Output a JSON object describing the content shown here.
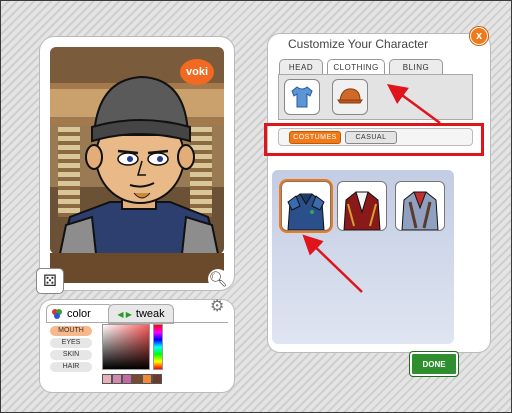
{
  "customize": {
    "title": "Customize Your Character",
    "close_label": "x",
    "tabs": [
      {
        "label": "HEAD",
        "active": false
      },
      {
        "label": "CLOTHING",
        "active": true
      },
      {
        "label": "BLING",
        "active": false
      }
    ],
    "categories": [
      {
        "icon": "shirt-icon",
        "active": true
      },
      {
        "icon": "cap-icon",
        "active": false
      }
    ],
    "styles": [
      {
        "label": "COSTUMES",
        "active": true
      },
      {
        "label": "CASUAL",
        "active": false
      }
    ],
    "items": [
      {
        "name": "blue-uniform-outfit",
        "selected": true
      },
      {
        "name": "red-coat-outfit",
        "selected": false
      },
      {
        "name": "denim-vest-outfit",
        "selected": false
      }
    ],
    "done_label": "DONE"
  },
  "character": {
    "logo_text": "voki",
    "dice_icon": "dice-icon",
    "zoom_icon": "magnifier-icon"
  },
  "color_panel": {
    "tab_color_label": "color",
    "tab_tweak_label": "tweak",
    "parts": [
      "MOUTH",
      "EYES",
      "SKIN",
      "HAIR"
    ],
    "active_part": "MOUTH",
    "swatches": [
      "#e7b0b8",
      "#d08ab0",
      "#c46aa0",
      "#7a4a2a",
      "#f08a3a",
      "#6a3a2a"
    ]
  },
  "colors": {
    "accent": "#f07a1a",
    "annotation": "#e0141b",
    "done_green": "#2f8f2f"
  }
}
